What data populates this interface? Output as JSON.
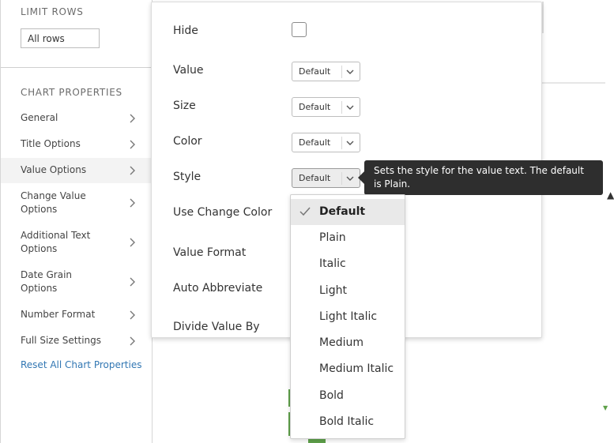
{
  "sidebar": {
    "limit_rows": {
      "title": "LIMIT ROWS",
      "value": "All rows"
    },
    "chart_properties": {
      "title": "CHART PROPERTIES",
      "items": [
        {
          "label": "General"
        },
        {
          "label": "Title Options"
        },
        {
          "label": "Value Options",
          "active": true
        },
        {
          "label": "Change Value Options"
        },
        {
          "label": "Additional Text Options"
        },
        {
          "label": "Date Grain Options"
        },
        {
          "label": "Number Format"
        },
        {
          "label": "Full Size Settings"
        }
      ],
      "reset_label": "Reset All Chart Properties"
    }
  },
  "panel": {
    "hide_label": "Hide",
    "hide_checked": false,
    "value_label": "Value",
    "value_select": "Default",
    "size_label": "Size",
    "size_select": "Default",
    "color_label": "Color",
    "color_select": "Default",
    "style_label": "Style",
    "style_select": "Default",
    "use_change_color_label": "Use Change Color",
    "value_format_label": "Value Format",
    "auto_abbreviate_label": "Auto Abbreviate",
    "divide_value_by_label": "Divide Value By"
  },
  "tooltip": {
    "text": "Sets the style for the value text. The default is Plain."
  },
  "style_dropdown": {
    "selected": "Default",
    "options": [
      "Default",
      "Plain",
      "Italic",
      "Light",
      "Light Italic",
      "Medium",
      "Medium Italic",
      "Bold",
      "Bold Italic"
    ]
  },
  "colors": {
    "link": "#3277b3",
    "tooltip_bg": "#2e2e2e",
    "chart_green": "#5fa14a",
    "selected_option_bg": "#e9e9e9"
  }
}
